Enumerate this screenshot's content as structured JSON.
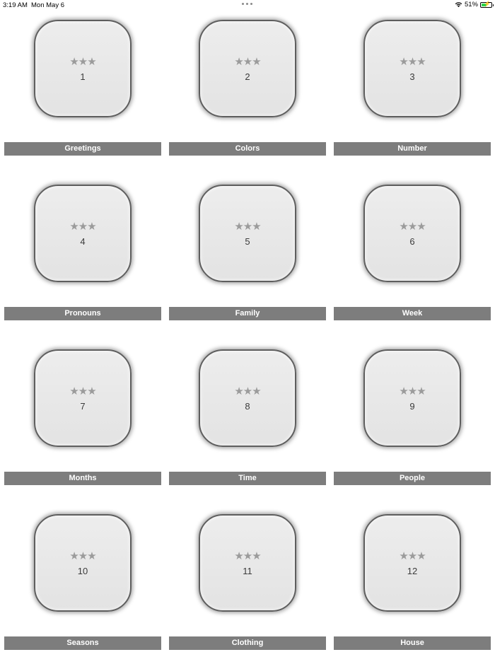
{
  "status_bar": {
    "time": "3:19 AM",
    "date": "Mon May 6",
    "battery_percent": "51%",
    "battery_level": 0.51,
    "wifi_icon": "wifi-icon",
    "battery_icon": "battery-charging-icon"
  },
  "colors": {
    "label_background": "#7d7d7d",
    "tile_background": "#e6e6e6",
    "star_color": "#9b9b9b"
  },
  "levels": [
    {
      "number": "1",
      "title": "Greetings",
      "stars": "★★★"
    },
    {
      "number": "2",
      "title": "Colors",
      "stars": "★★★"
    },
    {
      "number": "3",
      "title": "Number",
      "stars": "★★★"
    },
    {
      "number": "4",
      "title": "Pronouns",
      "stars": "★★★"
    },
    {
      "number": "5",
      "title": "Family",
      "stars": "★★★"
    },
    {
      "number": "6",
      "title": "Week",
      "stars": "★★★"
    },
    {
      "number": "7",
      "title": "Months",
      "stars": "★★★"
    },
    {
      "number": "8",
      "title": "Time",
      "stars": "★★★"
    },
    {
      "number": "9",
      "title": "People",
      "stars": "★★★"
    },
    {
      "number": "10",
      "title": "Seasons",
      "stars": "★★★"
    },
    {
      "number": "11",
      "title": "Clothing",
      "stars": "★★★"
    },
    {
      "number": "12",
      "title": "House",
      "stars": "★★★"
    }
  ]
}
